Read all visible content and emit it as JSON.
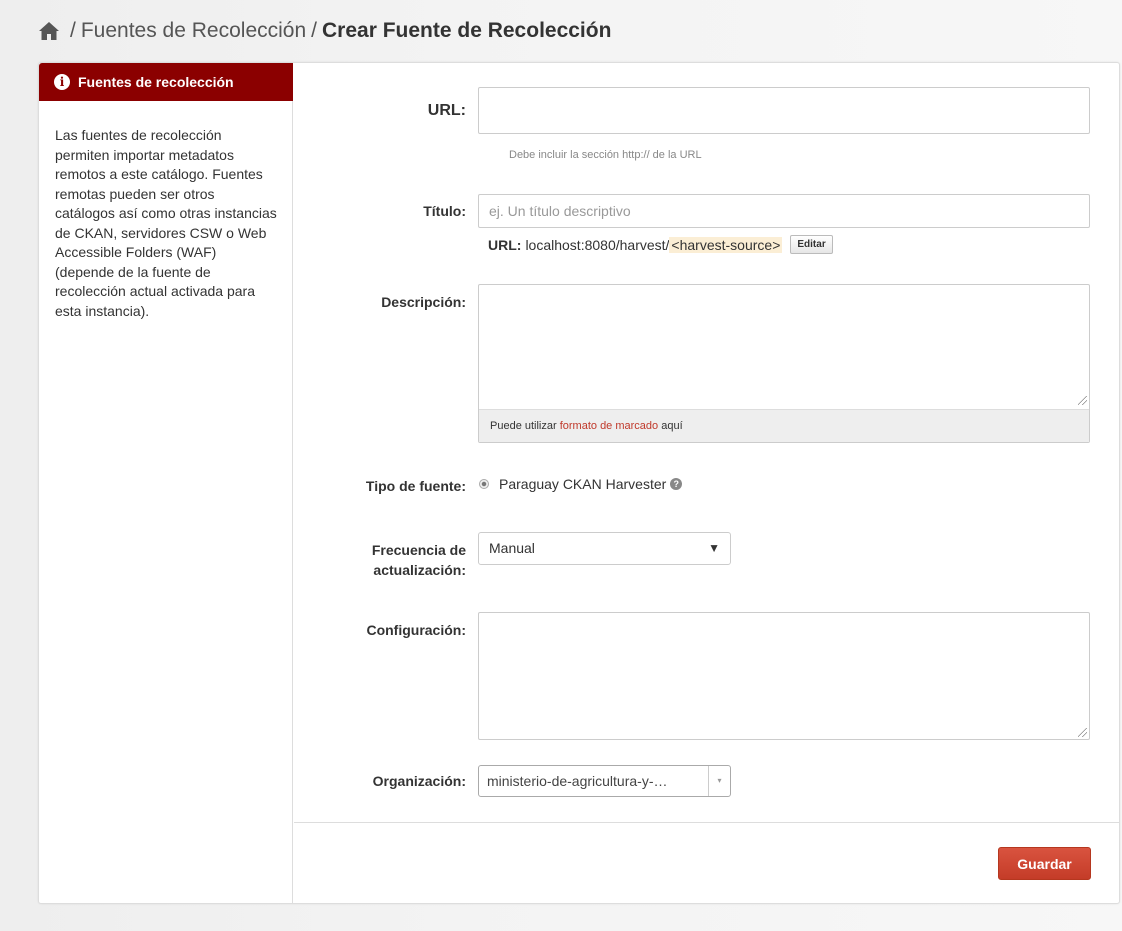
{
  "breadcrumb": {
    "home_icon": "home-icon",
    "separator": "/",
    "parent": "Fuentes de Recolección",
    "current": "Crear Fuente de Recolección"
  },
  "sidebar": {
    "title": "Fuentes de recolección",
    "icon": "info-icon",
    "text": "Las fuentes de recolección permiten importar metadatos remotos a este catálogo. Fuentes remotas pueden ser otros catálogos así como otras instancias de CKAN, servidores CSW o Web Accessible Folders (WAF) (depende de la fuente de recolección actual activada para esta instancia)."
  },
  "form": {
    "url": {
      "label": "URL:",
      "value": "",
      "help": "Debe incluir la sección http:// de la URL"
    },
    "title": {
      "label": "Título:",
      "placeholder": "ej. Un título descriptivo",
      "preview_label": "URL:",
      "preview_base": "localhost:8080/harvest/",
      "preview_slug": "<harvest-source>",
      "edit_button": "Editar"
    },
    "description": {
      "label": "Descripción:",
      "value": "",
      "markdown_prefix": "Puede utilizar ",
      "markdown_link": "formato de marcado",
      "markdown_suffix": " aquí"
    },
    "source_type": {
      "label": "Tipo de fuente:",
      "option": "Paraguay CKAN Harvester",
      "selected": true,
      "help_icon": "question-icon"
    },
    "frequency": {
      "label_line1": "Frecuencia de",
      "label_line2": "actualización:",
      "selected": "Manual",
      "arrow": "▼"
    },
    "config": {
      "label": "Configuración:",
      "value": ""
    },
    "organization": {
      "label": "Organización:",
      "selected": "ministerio-de-agricultura-y-…",
      "arrow": "▾"
    },
    "save_button": "Guardar"
  },
  "colors": {
    "sidebar_header": "#8b0000",
    "save_button": "#d04a36",
    "link": "#c0392b",
    "slug_highlight": "#fbeed5"
  }
}
